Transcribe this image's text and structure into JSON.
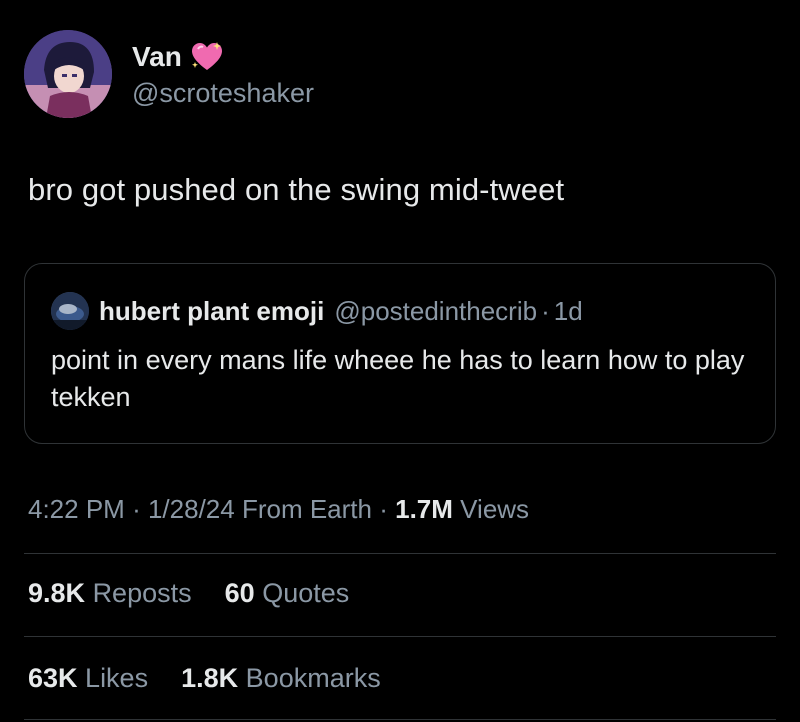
{
  "author": {
    "display_name": "Van",
    "handle": "@scroteshaker",
    "emoji_icon": "sparkling-heart-icon"
  },
  "tweet": {
    "text": "bro got pushed on the swing mid-tweet"
  },
  "quote": {
    "name": "hubert plant emoji",
    "handle": "@postedinthecrib",
    "separator": "·",
    "age": "1d",
    "text": "point in every mans life wheee he has to learn how to play tekken"
  },
  "meta": {
    "time": "4:22 PM",
    "sep1": "·",
    "date": "1/28/24",
    "source": "From Earth",
    "sep2": "·",
    "views_count": "1.7M",
    "views_label": "Views"
  },
  "stats": {
    "reposts_count": "9.8K",
    "reposts_label": "Reposts",
    "quotes_count": "60",
    "quotes_label": "Quotes",
    "likes_count": "63K",
    "likes_label": "Likes",
    "bookmarks_count": "1.8K",
    "bookmarks_label": "Bookmarks"
  },
  "colors": {
    "background": "#000000",
    "text_primary": "#e7e9ea",
    "text_secondary": "#8b98a5",
    "border": "#2f3336",
    "heart": "#f06ab0"
  }
}
